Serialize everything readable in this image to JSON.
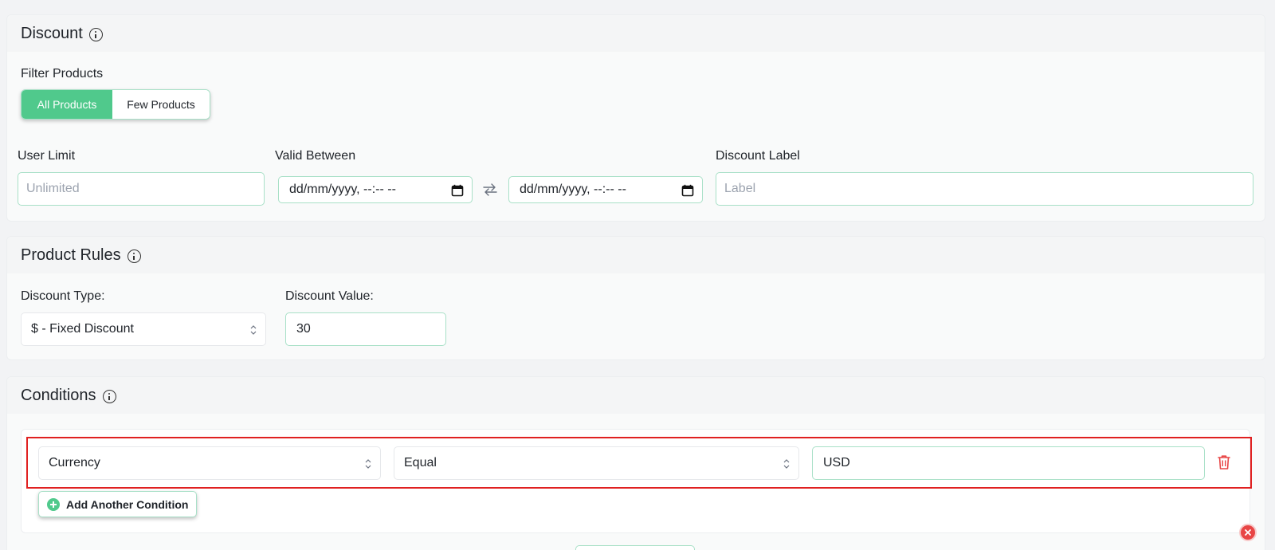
{
  "discount": {
    "title": "Discount",
    "info_icon": "info-icon",
    "filter_label": "Filter Products",
    "filter_options": [
      "All Products",
      "Few Products"
    ],
    "filter_selected": "All Products",
    "user_limit_label": "User Limit",
    "user_limit_placeholder": "Unlimited",
    "valid_between_label": "Valid Between",
    "date_start_placeholder": "dd/mm/yyyy, --:-- --",
    "date_end_placeholder": "dd/mm/yyyy, --:-- --",
    "swap_icon": "swap-arrows-icon",
    "calendar_icon": "calendar-icon",
    "discount_label_label": "Discount Label",
    "discount_label_placeholder": "Label"
  },
  "product_rules": {
    "title": "Product Rules",
    "discount_type_label": "Discount Type:",
    "discount_type_value": "$ - Fixed Discount",
    "discount_value_label": "Discount Value:",
    "discount_value": "30"
  },
  "conditions": {
    "title": "Conditions",
    "rows": [
      {
        "field": "Currency",
        "operator": "Equal",
        "value": "USD"
      }
    ],
    "add_label": "Add Another Condition",
    "delete_icon": "trash-icon"
  },
  "colors": {
    "accent": "#50c98c",
    "input_border": "#a8e0c7",
    "highlight": "#e02020",
    "delete": "#e84545"
  }
}
